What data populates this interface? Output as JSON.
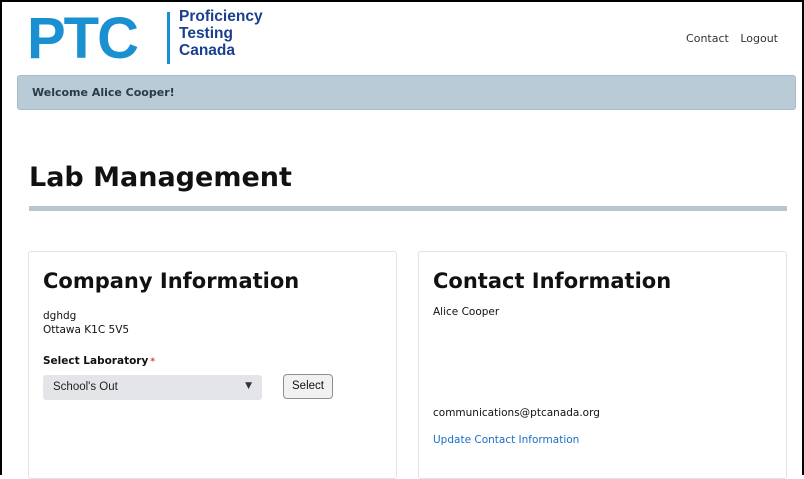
{
  "logo": {
    "mark": "PTC",
    "line1": "Proficiency",
    "line2": "Testing",
    "line3": "Canada",
    "color_primary": "#1b90d1",
    "color_text": "#1b3f8f"
  },
  "topnav": {
    "items": [
      "Contact",
      "Logout"
    ]
  },
  "welcome": {
    "text": "Welcome Alice Cooper!",
    "background": "#b8cbd6"
  },
  "page": {
    "title": "Lab Management"
  },
  "company": {
    "heading": "Company Information",
    "name": "dghdg",
    "address": "Ottawa K1C 5V5",
    "select_label": "Select Laboratory",
    "required_mark": "*",
    "selected_value": "School's Out",
    "select_button": "Select"
  },
  "contact": {
    "heading": "Contact Information",
    "name": "Alice Cooper",
    "email": "communications@ptcanada.org",
    "update_link": "Update Contact Information",
    "link_color": "#1a6fc4"
  }
}
